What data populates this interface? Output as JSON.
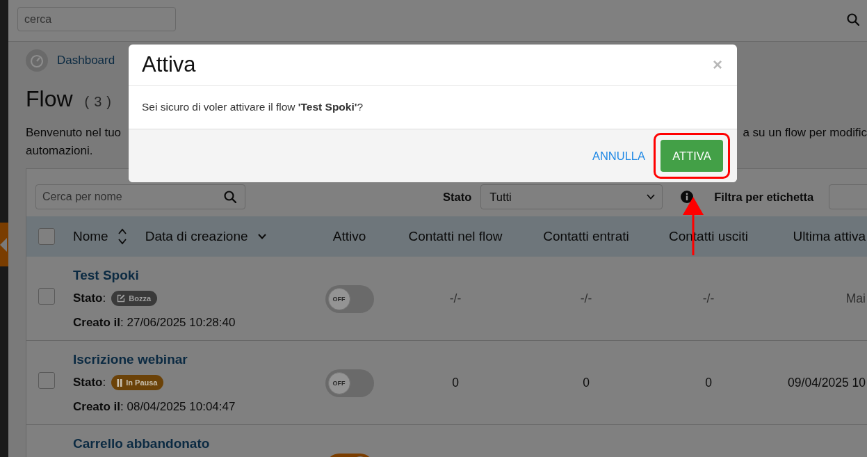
{
  "top_bar": {
    "search": {
      "placeholder": "cerca"
    }
  },
  "breadcrumb": [
    {
      "label": "Dashboard"
    }
  ],
  "header": {
    "title": "Flow",
    "count": "(3)"
  },
  "description": {
    "lines": [
      {
        "fragments": [
          "Benvenuto nel tuo",
          "a su un flow per modific"
        ]
      },
      {
        "fragments": [
          "automazioni."
        ]
      }
    ]
  },
  "toolbar": {
    "search": {
      "placeholder": "Cerca per nome"
    },
    "status_filter": {
      "label": "Stato",
      "value": "Tutti"
    },
    "tag_filter": {
      "label": "Filtra per etichetta"
    }
  },
  "table": {
    "select_all": {
      "checked": false
    },
    "columns": [
      {
        "label": "Nome",
        "kind": "sortable"
      },
      {
        "label": "Data di creazione",
        "kind": "sorted"
      },
      {
        "label": "Attivo",
        "kind": "plain"
      },
      {
        "label": "Contatti nel flow",
        "kind": "plain"
      },
      {
        "label": "Contatti entrati",
        "kind": "plain"
      },
      {
        "label": "Contatti usciti",
        "kind": "plain"
      },
      {
        "label": "Ultima attiva",
        "kind": "plain"
      }
    ],
    "rows": [
      {
        "name": "Test Spoki",
        "status_label": "**Stato**:",
        "status": {
          "label": "Bozza",
          "kind": "draft"
        },
        "created": "**Creato il**: 27/06/2025 10:28:40",
        "active": false,
        "toggle_text": "OFF",
        "values": [
          "-/-",
          "-/-",
          "-/-",
          "Mai"
        ],
        "checked": false
      },
      {
        "name": "Iscrizione webinar",
        "status_label": "**Stato**:",
        "status": {
          "label": "In Pausa",
          "kind": "paused"
        },
        "created": "**Creato il**: 08/04/2025 10:04:47",
        "active": false,
        "toggle_text": "OFF",
        "values": [
          "0",
          "0",
          "0",
          "09/04/2025 10"
        ],
        "checked": false
      },
      {
        "name": "Carrello abbandonato",
        "active": true
      }
    ]
  },
  "modal": {
    "title": "Attiva",
    "close": "×",
    "message": "Sei sicuro di voler attivare il flow **'Test Spoki'**?",
    "buttons": [
      {
        "label": "ANNULLA",
        "kind": "link",
        "highlighted": false
      },
      {
        "label": "ATTIVA",
        "kind": "primary",
        "highlighted": true
      }
    ]
  }
}
